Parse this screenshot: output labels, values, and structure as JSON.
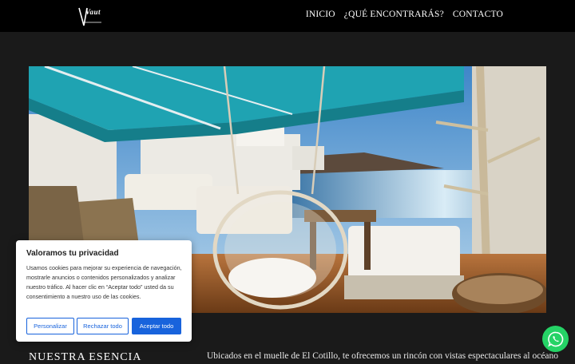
{
  "header": {
    "logo_text": "Vaut",
    "nav": [
      "INICIO",
      "¿QUÉ ENCONTRARÁS?",
      "CONTACTO"
    ]
  },
  "hero": {
    "icon": "terrace-photo"
  },
  "section": {
    "title": "NUESTRA ESENCIA",
    "text": "Ubicados en el muelle de El Cotillo, te ofrecemos un rincón con vistas espectaculares al océano. Hemos"
  },
  "cookie": {
    "title": "Valoramos tu privacidad",
    "body": "Usamos cookies para mejorar su experiencia de navegación, mostrarle anuncios o contenidos personalizados y analizar nuestro tráfico. Al hacer clic en “Aceptar todo” usted da su consentimiento a nuestro uso de las cookies.",
    "customize": "Personalizar",
    "reject": "Rechazar todo",
    "accept": "Aceptar todo",
    "accent": "#1863dc"
  },
  "whatsapp": {
    "icon": "whatsapp-icon",
    "color": "#25d366"
  }
}
